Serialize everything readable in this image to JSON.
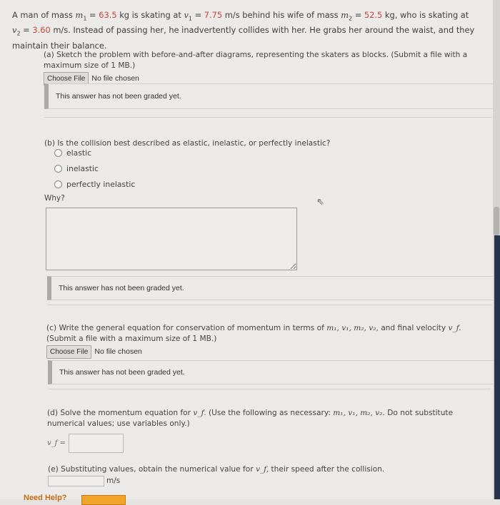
{
  "intro": {
    "p1": "A man of mass ",
    "m1_sym": "m",
    "m1_sub": "1",
    "eq": " = ",
    "m1_val": "63.5",
    "p2": " kg is skating at ",
    "v1_sym": "v",
    "v1_sub": "1",
    "v1_val": "7.75",
    "p3": " m/s behind his wife of mass ",
    "m2_sym": "m",
    "m2_sub": "2",
    "m2_val": "52.5",
    "p4": " kg, who is skating at",
    "v2_sym": "v",
    "v2_sub": "2",
    "v2_val": "3.60",
    "p5": " m/s. Instead of passing her, he inadvertently collides with her. He grabs her around the waist, and they maintain their balance."
  },
  "part_a": {
    "text": "(a) Sketch the problem with before-and-after diagrams, representing the skaters as blocks. (Submit a file with a maximum size of 1 MB.)",
    "choose_file": "Choose File",
    "no_file": "No file chosen",
    "graded": "This answer has not been graded yet."
  },
  "part_b": {
    "text": "(b) Is the collision best described as elastic, inelastic, or perfectly inelastic?",
    "options": [
      "elastic",
      "inelastic",
      "perfectly inelastic"
    ],
    "why": "Why?",
    "graded": "This answer has not been graded yet."
  },
  "part_c": {
    "text_a": "(c) Write the general equation for conservation of momentum in terms of ",
    "vars": "m₁, v₁, m₂, v₂,",
    "text_b": " and final velocity ",
    "vf": "v_f.",
    "text_c": "(Submit a file with a maximum size of 1 MB.)",
    "choose_file": "Choose File",
    "no_file": "No file chosen",
    "graded": "This answer has not been graded yet."
  },
  "part_d": {
    "text_a": "(d) Solve the momentum equation for ",
    "vf": "v_f.",
    "text_b": " (Use the following as necessary: ",
    "vars": "m₁, v₁, m₂, v₂.",
    "text_c": " Do not substitute numerical values; use variables only.)",
    "label": "v_f =",
    "value": ""
  },
  "part_e": {
    "text_a": "(e) Substituting values, obtain the numerical value for ",
    "vf": "v_f,",
    "text_b": " their speed after the collision.",
    "value": "",
    "unit": "m/s"
  },
  "help": {
    "label": "Need Help?"
  },
  "colors": {
    "given_value": "#c9443a",
    "help": "#c56b12",
    "help_button": "#f1a42a"
  }
}
